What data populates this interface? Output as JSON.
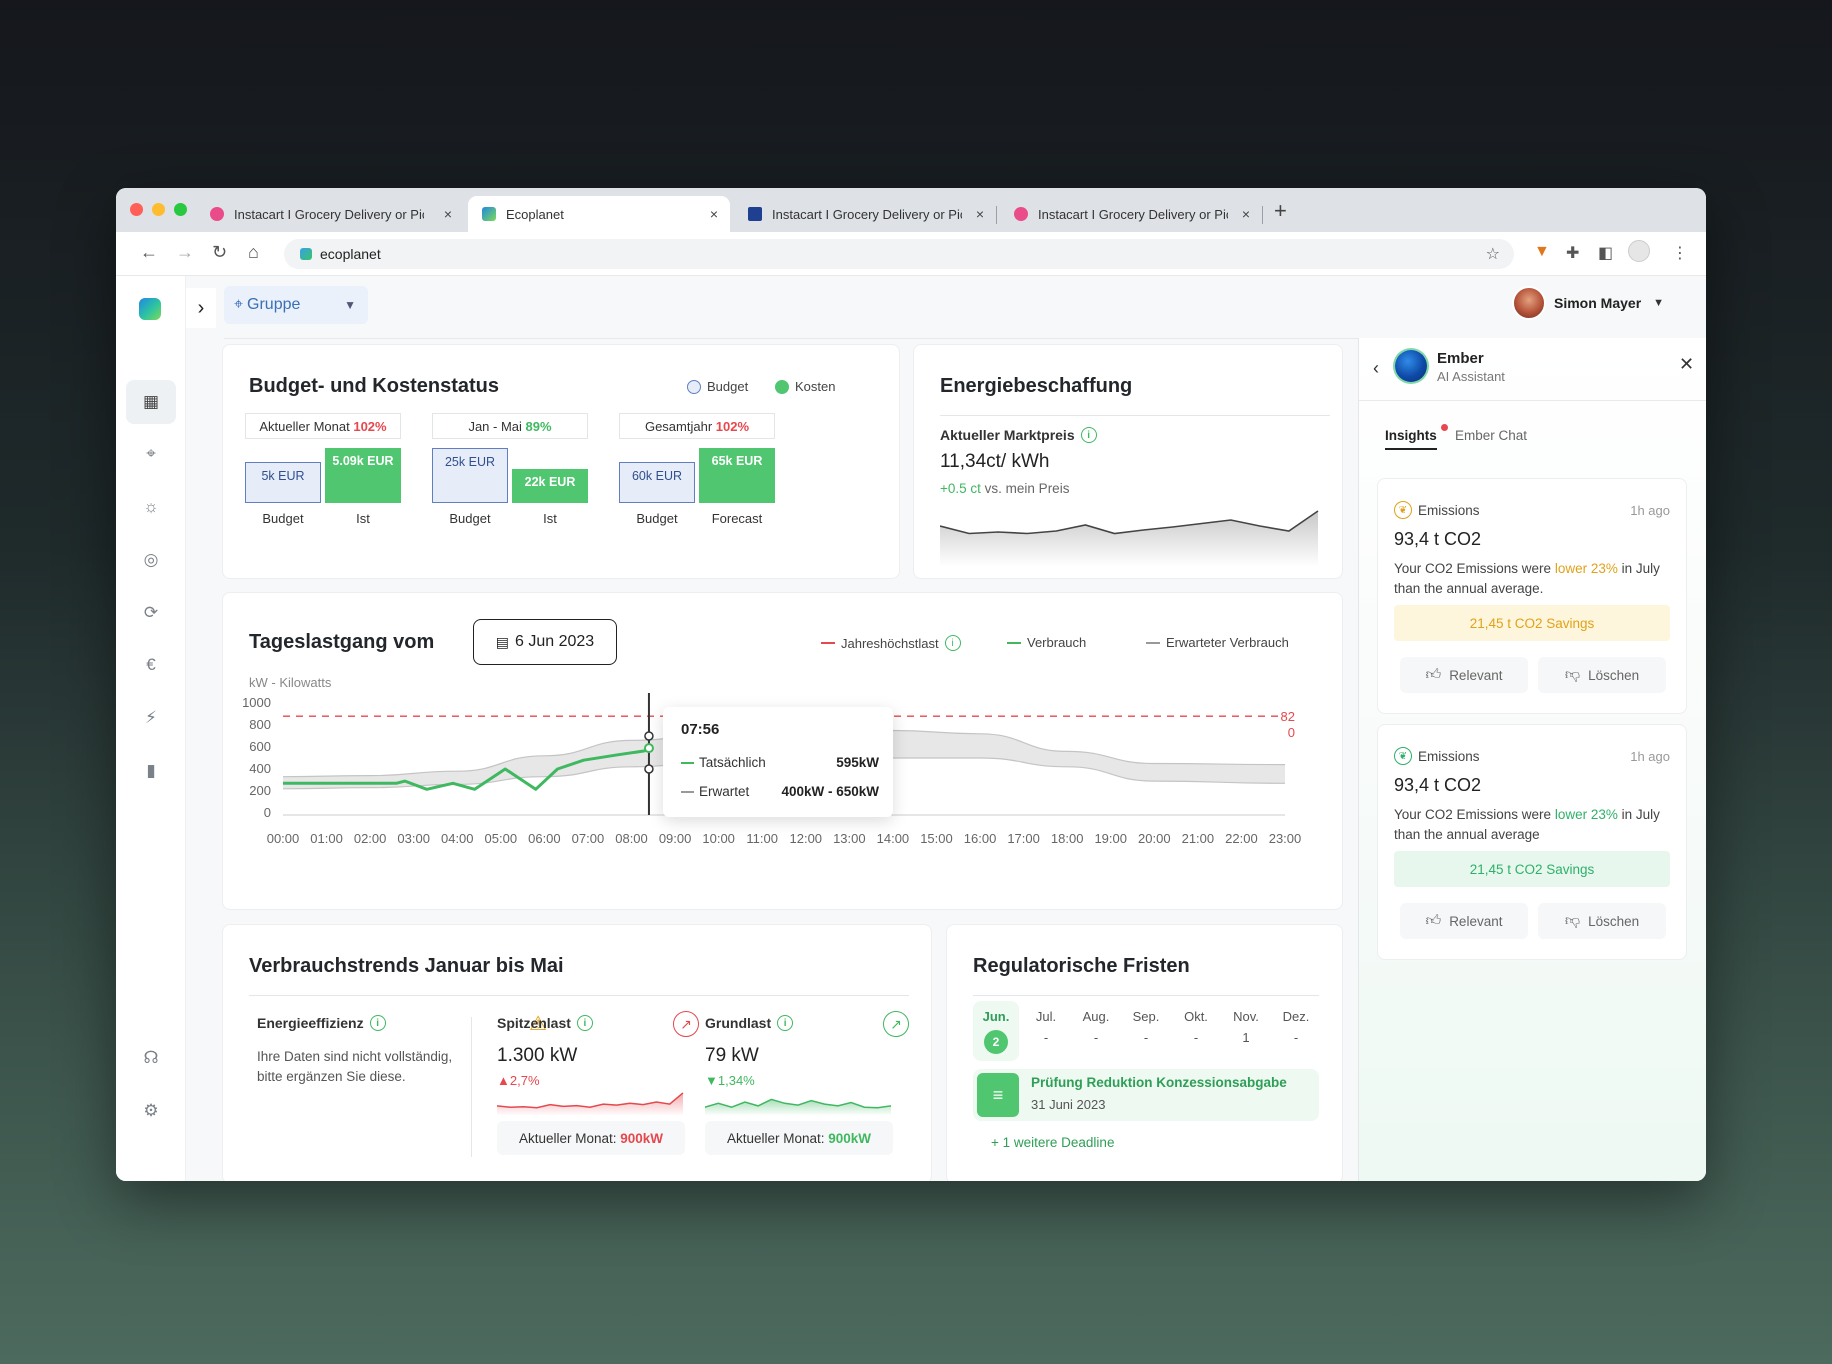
{
  "browser": {
    "tabs": [
      {
        "title": "Instacart I Grocery Delivery or Pickup",
        "icon": "dribbble-icon",
        "active": false
      },
      {
        "title": "Ecoplanet",
        "icon": "ecoplanet-icon",
        "active": true
      },
      {
        "title": "Instacart I Grocery Delivery or Pickup",
        "icon": "paypal-icon",
        "active": false
      },
      {
        "title": "Instacart I Grocery Delivery or Pickup",
        "icon": "dribbble-icon",
        "active": false
      }
    ],
    "close_glyph": "×",
    "new_tab_glyph": "+",
    "url": "ecoplanet"
  },
  "header": {
    "group_label": "Gruppe",
    "user_name": "Simon Mayer"
  },
  "budget": {
    "title": "Budget- und Kostenstatus",
    "legend_budget": "Budget",
    "legend_kosten": "Kosten",
    "groups": [
      {
        "label": "Aktueller Monat",
        "pct": "102%",
        "pct_color": "#e5484d",
        "budget": "5k EUR",
        "actual": "5.09k EUR",
        "l1": "Budget",
        "l2": "Ist",
        "budget_ratio": 0.68,
        "actual_ratio": 0.92
      },
      {
        "label": "Jan - Mai",
        "pct": "89%",
        "pct_color": "#3fb860",
        "budget": "25k EUR",
        "actual": "22k EUR",
        "l1": "Budget",
        "l2": "Ist",
        "budget_ratio": 0.92,
        "actual_ratio": 0.56
      },
      {
        "label": "Gesamtjahr",
        "pct": "102%",
        "pct_color": "#e5484d",
        "budget": "60k EUR",
        "actual": "65k EUR",
        "l1": "Budget",
        "l2": "Forecast",
        "budget_ratio": 0.68,
        "actual_ratio": 0.92
      }
    ]
  },
  "energy": {
    "title": "Energiebeschaffung",
    "price_label": "Aktueller Marktpreis",
    "price": "11,34ct/ kWh",
    "delta": "+0.5 ct",
    "delta_suffix": "vs. mein Preis",
    "spark": [
      0.7,
      0.55,
      0.58,
      0.55,
      0.6,
      0.72,
      0.55,
      0.62,
      0.68,
      0.75,
      0.82,
      0.7,
      0.6,
      1.0
    ]
  },
  "load": {
    "title": "Tageslastgang vom",
    "date": "6 Jun 2023",
    "legend_max": "Jahreshöchstlast",
    "legend_use": "Verbrauch",
    "legend_expected": "Erwarteter Verbrauch",
    "unit": "kW - Kilowatts",
    "max_label_1": "82",
    "max_label_2": "0",
    "tooltip": {
      "time": "07:56",
      "actual_label": "Tatsächlich",
      "actual_value": "595kW",
      "expected_label": "Erwartet",
      "expected_value": "400kW - 650kW"
    }
  },
  "chart_data": {
    "type": "line",
    "title": "Tageslastgang vom",
    "ylabel": "kW - Kilowatts",
    "ylim": [
      0,
      1000
    ],
    "yticks": [
      1000,
      800,
      600,
      400,
      200,
      0
    ],
    "x": [
      "00:00",
      "01:00",
      "02:00",
      "03:00",
      "04:00",
      "05:00",
      "06:00",
      "07:00",
      "08:00",
      "09:00",
      "10:00",
      "11:00",
      "12:00",
      "13:00",
      "14:00",
      "15:00",
      "16:00",
      "17:00",
      "18:00",
      "19:00",
      "20:00",
      "21:00",
      "22:00",
      "23:00"
    ],
    "reference_line": {
      "name": "Jahreshöchstlast",
      "value": 880,
      "color": "#e5484d"
    },
    "series": [
      {
        "name": "Verbrauch",
        "color": "#3fb860",
        "points": [
          [
            0,
            270
          ],
          [
            1.3,
            270
          ],
          [
            2.6,
            270
          ],
          [
            2.8,
            290
          ],
          [
            3.3,
            215
          ],
          [
            3.9,
            270
          ],
          [
            4.4,
            215
          ],
          [
            5.1,
            400
          ],
          [
            5.8,
            215
          ],
          [
            6.3,
            400
          ],
          [
            6.9,
            480
          ],
          [
            7.7,
            530
          ],
          [
            8.3,
            565
          ],
          [
            8.4,
            590
          ]
        ]
      },
      {
        "name": "Erwarteter Verbrauch (min)",
        "points": [
          [
            0,
            220
          ],
          [
            2,
            230
          ],
          [
            4,
            260
          ],
          [
            6,
            330
          ],
          [
            8,
            420
          ],
          [
            10,
            470
          ],
          [
            12,
            490
          ],
          [
            14,
            500
          ],
          [
            16,
            500
          ],
          [
            18,
            420
          ],
          [
            20,
            290
          ],
          [
            23,
            270
          ]
        ]
      },
      {
        "name": "Erwarteter Verbrauch (max)",
        "points": [
          [
            0,
            330
          ],
          [
            2,
            340
          ],
          [
            4,
            380
          ],
          [
            6,
            520
          ],
          [
            8,
            660
          ],
          [
            10,
            720
          ],
          [
            12,
            740
          ],
          [
            14,
            750
          ],
          [
            16,
            720
          ],
          [
            18,
            560
          ],
          [
            20,
            450
          ],
          [
            23,
            440
          ]
        ]
      }
    ],
    "cursor_x": 8.4
  },
  "trends": {
    "title": "Verbrauchstrends Januar bis Mai",
    "efficiency": {
      "label": "Energieeffizienz",
      "text": "Ihre Daten sind nicht vollständig, bitte ergänzen Sie diese."
    },
    "peak": {
      "label": "Spitzenlast",
      "value": "1.300 kW",
      "delta": "▲2,7%",
      "month_label": "Aktueller Monat:",
      "month_value": "900kW"
    },
    "base": {
      "label": "Grundlast",
      "value": "79 kW",
      "delta": "▼1,34%",
      "month_label": "Aktueller Monat:",
      "month_value": "900kW"
    }
  },
  "regulatory": {
    "title": "Regulatorische Fristen",
    "months": [
      {
        "m": "Jun.",
        "v": "2"
      },
      {
        "m": "Jul.",
        "v": "-"
      },
      {
        "m": "Aug.",
        "v": "-"
      },
      {
        "m": "Sep.",
        "v": "-"
      },
      {
        "m": "Okt.",
        "v": "-"
      },
      {
        "m": "Nov.",
        "v": "1"
      },
      {
        "m": "Dez.",
        "v": "-"
      }
    ],
    "deadline_title": "Prüfung Reduktion Konzessionsabgabe",
    "deadline_date": "31 Juni 2023",
    "more": "+ 1 weitere Deadline"
  },
  "ember": {
    "name": "Ember",
    "subtitle": "AI Assistant",
    "tab_insights": "Insights",
    "tab_chat": "Ember Chat",
    "cards": [
      {
        "category": "Emissions",
        "time": "1h ago",
        "value": "93,4 t CO2",
        "text_a": "Your CO2 Emissions were ",
        "highlight": "lower 23%",
        "text_b": " in July than the annual average.",
        "savings": "21,45 t CO2 Savings",
        "accent": "#e0a21a",
        "bg": "#fdf6dc",
        "relevant": "Relevant",
        "delete": "Löschen"
      },
      {
        "category": "Emissions",
        "time": "1h ago",
        "value": "93,4 t CO2",
        "text_a": "Your CO2 Emissions were ",
        "highlight": "lower 23%",
        "text_b": " in July than the annual average",
        "savings": "21,45 t CO2 Savings",
        "accent": "#2fb06a",
        "bg": "#e7f7ee",
        "relevant": "Relevant",
        "delete": "Löschen"
      }
    ]
  }
}
